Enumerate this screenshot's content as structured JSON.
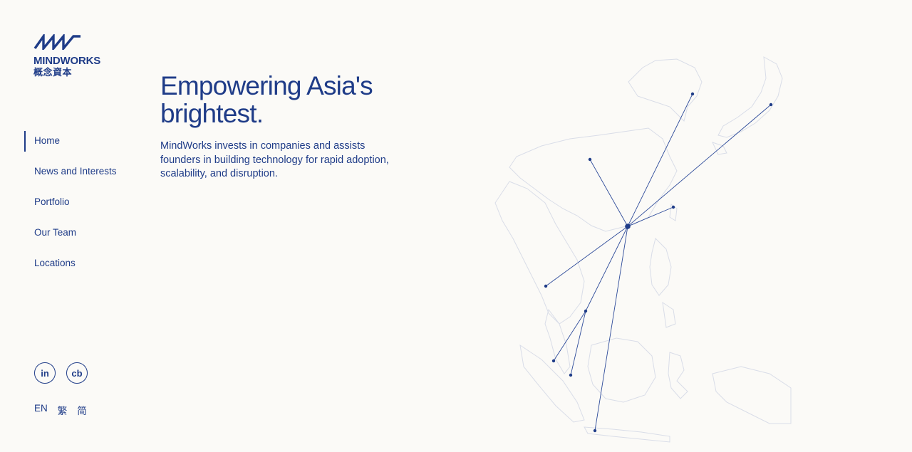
{
  "brand": {
    "name": "MINDWORKS",
    "name_cjk": "概念資本"
  },
  "nav": {
    "items": [
      {
        "label": "Home",
        "active": true
      },
      {
        "label": "News and Interests",
        "active": false
      },
      {
        "label": "Portfolio",
        "active": false
      },
      {
        "label": "Our Team",
        "active": false
      },
      {
        "label": "Locations",
        "active": false
      }
    ]
  },
  "hero": {
    "headline": "Empowering Asia's brightest.",
    "description": "MindWorks invests in companies and assists founders in building technology for rapid adoption, scalability, and disruption."
  },
  "social": {
    "linkedin_label": "in",
    "crunchbase_label": "cb"
  },
  "languages": {
    "en": "EN",
    "traditional": "繁",
    "simplified": "简"
  },
  "theme": {
    "primary": "#1f3c88",
    "background": "#fbfaf7",
    "map_outline": "#d9dde8"
  }
}
